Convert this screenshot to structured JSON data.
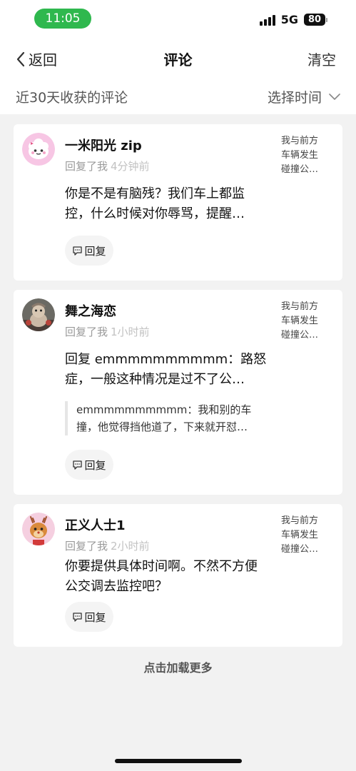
{
  "status_bar": {
    "time": "11:05",
    "network": "5G",
    "battery": "80"
  },
  "nav": {
    "back_label": "返回",
    "title": "评论",
    "clear_label": "清空"
  },
  "filter": {
    "label": "近30天收获的评论",
    "time_select": "选择时间"
  },
  "comments": [
    {
      "username": "一米阳光 zip",
      "reply_prefix": "回复了我",
      "time_ago": "4分钟前",
      "content": "你是不是有脑残？我们车上都监控，什么时候对你辱骂，提醒…",
      "source_lines": [
        "我与前方",
        "车辆发生",
        "碰撞公…"
      ],
      "reply_label": "回复"
    },
    {
      "username": "舞之海恋",
      "reply_prefix": "回复了我",
      "time_ago": "1小时前",
      "content": "回复 emmmmmmmmmm：路怒症，一般这种情况是过不了公…",
      "quote": "emmmmmmmmmm：我和别的车撞，他觉得挡他道了，下来就开怼…",
      "source_lines": [
        "我与前方",
        "车辆发生",
        "碰撞公…"
      ],
      "reply_label": "回复"
    },
    {
      "username": "正义人士1",
      "reply_prefix": "回复了我",
      "time_ago": "2小时前",
      "content": "你要提供具体时间啊。不然不方便公交调去监控吧？",
      "source_lines": [
        "我与前方",
        "车辆发生",
        "碰撞公…"
      ],
      "reply_label": "回复"
    }
  ],
  "load_more": "点击加载更多",
  "icons": {
    "back": "chevron-left-icon",
    "dropdown": "chevron-down-icon",
    "reply": "comment-bubble-icon"
  },
  "colors": {
    "time_pill": "#2fb84e",
    "background": "#f2f2f2"
  }
}
